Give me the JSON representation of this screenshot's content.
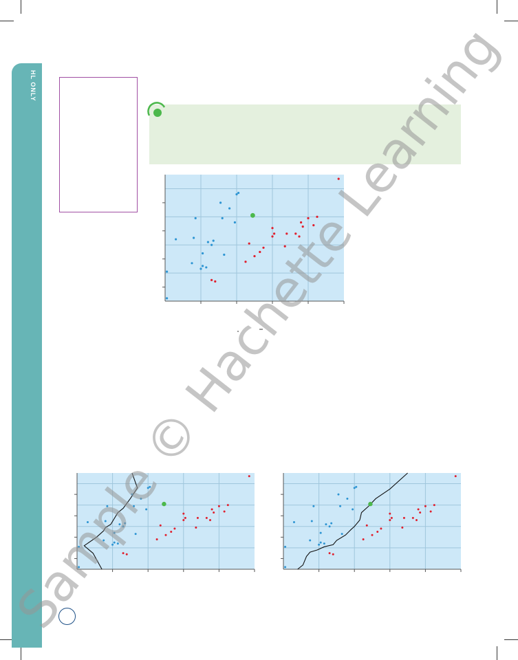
{
  "page": {
    "side_label": "HL ONLY",
    "watermark": "Sample © Hachette Learning",
    "colors": {
      "side_band": "#67b5b6",
      "margin_box_border": "#a04ea3",
      "green_box": "#e4f0de",
      "plot_bg": "#cde8f8",
      "blue_points": "#2e95d3",
      "red_points": "#e0202e",
      "green_point": "#4cb84c"
    },
    "icons": [
      "green-circle-icon",
      "page-number-circle"
    ]
  },
  "chart_data": [
    {
      "type": "scatter",
      "title": "",
      "xlabel": "",
      "ylabel": "",
      "grid": true,
      "xlim": [
        0,
        10
      ],
      "ylim": [
        0,
        9
      ],
      "series": [
        {
          "color": "blue",
          "points": [
            [
              0.1,
              0.2
            ],
            [
              0.1,
              2.1
            ],
            [
              0.6,
              4.4
            ],
            [
              1.5,
              2.7
            ],
            [
              1.6,
              4.5
            ],
            [
              1.7,
              5.9
            ],
            [
              2,
              2.3
            ],
            [
              2.1,
              2.5
            ],
            [
              2.1,
              3.4
            ],
            [
              2.3,
              2.4
            ],
            [
              2.4,
              4.2
            ],
            [
              2.6,
              4
            ],
            [
              2.7,
              4.3
            ],
            [
              3.1,
              7
            ],
            [
              3.2,
              5.9
            ],
            [
              3.3,
              3.3
            ],
            [
              3.6,
              6.6
            ],
            [
              3.9,
              5.6
            ],
            [
              4,
              7.6
            ],
            [
              4.1,
              7.7
            ]
          ]
        },
        {
          "color": "red",
          "points": [
            [
              2.6,
              1.5
            ],
            [
              2.8,
              1.4
            ],
            [
              4.5,
              2.8
            ],
            [
              4.7,
              4.1
            ],
            [
              5,
              3.2
            ],
            [
              5.3,
              3.5
            ],
            [
              5.5,
              3.8
            ],
            [
              6,
              4.6
            ],
            [
              6,
              5.2
            ],
            [
              6.1,
              4.8
            ],
            [
              6.7,
              3.9
            ],
            [
              6.8,
              4.8
            ],
            [
              7.3,
              4.8
            ],
            [
              7.5,
              4.6
            ],
            [
              7.6,
              5.6
            ],
            [
              7.7,
              5.3
            ],
            [
              8,
              5.9
            ],
            [
              8.3,
              5.4
            ],
            [
              8.5,
              6
            ],
            [
              9.7,
              8.7
            ]
          ]
        },
        {
          "color": "green",
          "points": [
            [
              4.9,
              6.1
            ]
          ]
        }
      ]
    },
    {
      "type": "scatter",
      "title": "",
      "xlabel": "",
      "ylabel": "",
      "grid": true,
      "xlim": [
        0,
        10
      ],
      "ylim": [
        0,
        9
      ],
      "boundary": [
        [
          3.1,
          9
        ],
        [
          3.4,
          7.6
        ],
        [
          3,
          6.6
        ],
        [
          2.6,
          5.7
        ],
        [
          2.3,
          5.3
        ],
        [
          1.9,
          4.2
        ],
        [
          1.6,
          3.9
        ],
        [
          1.5,
          3.6
        ],
        [
          1.3,
          3.3
        ],
        [
          1.1,
          3
        ],
        [
          0.4,
          2.2
        ],
        [
          0.9,
          1.5
        ],
        [
          1.4,
          0
        ]
      ],
      "series": [
        {
          "color": "blue",
          "points": [
            [
              0.1,
              0.2
            ],
            [
              0.1,
              2.1
            ],
            [
              0.6,
              4.4
            ],
            [
              1.5,
              2.7
            ],
            [
              1.6,
              4.5
            ],
            [
              1.7,
              5.9
            ],
            [
              2,
              2.3
            ],
            [
              2.1,
              2.5
            ],
            [
              2.1,
              3.4
            ],
            [
              2.3,
              2.4
            ],
            [
              2.4,
              4.2
            ],
            [
              2.6,
              4
            ],
            [
              2.7,
              4.3
            ],
            [
              3.1,
              7
            ],
            [
              3.2,
              5.9
            ],
            [
              3.3,
              3.3
            ],
            [
              3.6,
              6.6
            ],
            [
              3.9,
              5.6
            ],
            [
              4,
              7.6
            ],
            [
              4.1,
              7.7
            ]
          ]
        },
        {
          "color": "red",
          "points": [
            [
              2.6,
              1.5
            ],
            [
              2.8,
              1.4
            ],
            [
              4.5,
              2.8
            ],
            [
              4.7,
              4.1
            ],
            [
              5,
              3.2
            ],
            [
              5.3,
              3.5
            ],
            [
              5.5,
              3.8
            ],
            [
              6,
              4.6
            ],
            [
              6,
              5.2
            ],
            [
              6.1,
              4.8
            ],
            [
              6.7,
              3.9
            ],
            [
              6.8,
              4.8
            ],
            [
              7.3,
              4.8
            ],
            [
              7.5,
              4.6
            ],
            [
              7.6,
              5.6
            ],
            [
              7.7,
              5.3
            ],
            [
              8,
              5.9
            ],
            [
              8.3,
              5.4
            ],
            [
              8.5,
              6
            ],
            [
              9.7,
              8.7
            ]
          ]
        },
        {
          "color": "green",
          "points": [
            [
              4.9,
              6.1
            ]
          ]
        }
      ]
    },
    {
      "type": "scatter",
      "title": "",
      "xlabel": "",
      "ylabel": "",
      "grid": true,
      "xlim": [
        0,
        10
      ],
      "ylim": [
        0,
        9
      ],
      "boundary": [
        [
          7,
          9
        ],
        [
          6,
          7.5
        ],
        [
          5.2,
          6.6
        ],
        [
          4.8,
          5.9
        ],
        [
          4.4,
          5.3
        ],
        [
          4.3,
          4.6
        ],
        [
          4,
          4
        ],
        [
          3.8,
          3.7
        ],
        [
          3.5,
          3.2
        ],
        [
          3,
          2.7
        ],
        [
          2.8,
          2.3
        ],
        [
          2.3,
          2.1
        ],
        [
          1.9,
          1.8
        ],
        [
          1.5,
          1.6
        ],
        [
          1.3,
          1.2
        ],
        [
          1.1,
          0.4
        ],
        [
          0.8,
          0
        ]
      ],
      "series": [
        {
          "color": "blue",
          "points": [
            [
              0.1,
              0.2
            ],
            [
              0.1,
              2.1
            ],
            [
              0.6,
              4.4
            ],
            [
              1.5,
              2.7
            ],
            [
              1.6,
              4.5
            ],
            [
              1.7,
              5.9
            ],
            [
              2,
              2.3
            ],
            [
              2.1,
              2.5
            ],
            [
              2.1,
              3.4
            ],
            [
              2.3,
              2.4
            ],
            [
              2.4,
              4.2
            ],
            [
              2.6,
              4
            ],
            [
              2.7,
              4.3
            ],
            [
              3.1,
              7
            ],
            [
              3.2,
              5.9
            ],
            [
              3.3,
              3.3
            ],
            [
              3.6,
              6.6
            ],
            [
              3.9,
              5.6
            ],
            [
              4,
              7.6
            ],
            [
              4.1,
              7.7
            ]
          ]
        },
        {
          "color": "red",
          "points": [
            [
              2.6,
              1.5
            ],
            [
              2.8,
              1.4
            ],
            [
              4.5,
              2.8
            ],
            [
              4.7,
              4.1
            ],
            [
              5,
              3.2
            ],
            [
              5.3,
              3.5
            ],
            [
              5.5,
              3.8
            ],
            [
              6,
              4.6
            ],
            [
              6,
              5.2
            ],
            [
              6.1,
              4.8
            ],
            [
              6.7,
              3.9
            ],
            [
              6.8,
              4.8
            ],
            [
              7.3,
              4.8
            ],
            [
              7.5,
              4.6
            ],
            [
              7.6,
              5.6
            ],
            [
              7.7,
              5.3
            ],
            [
              8,
              5.9
            ],
            [
              8.3,
              5.4
            ],
            [
              8.5,
              6
            ],
            [
              9.7,
              8.7
            ]
          ]
        },
        {
          "color": "green",
          "points": [
            [
              4.9,
              6.1
            ]
          ]
        }
      ]
    }
  ]
}
